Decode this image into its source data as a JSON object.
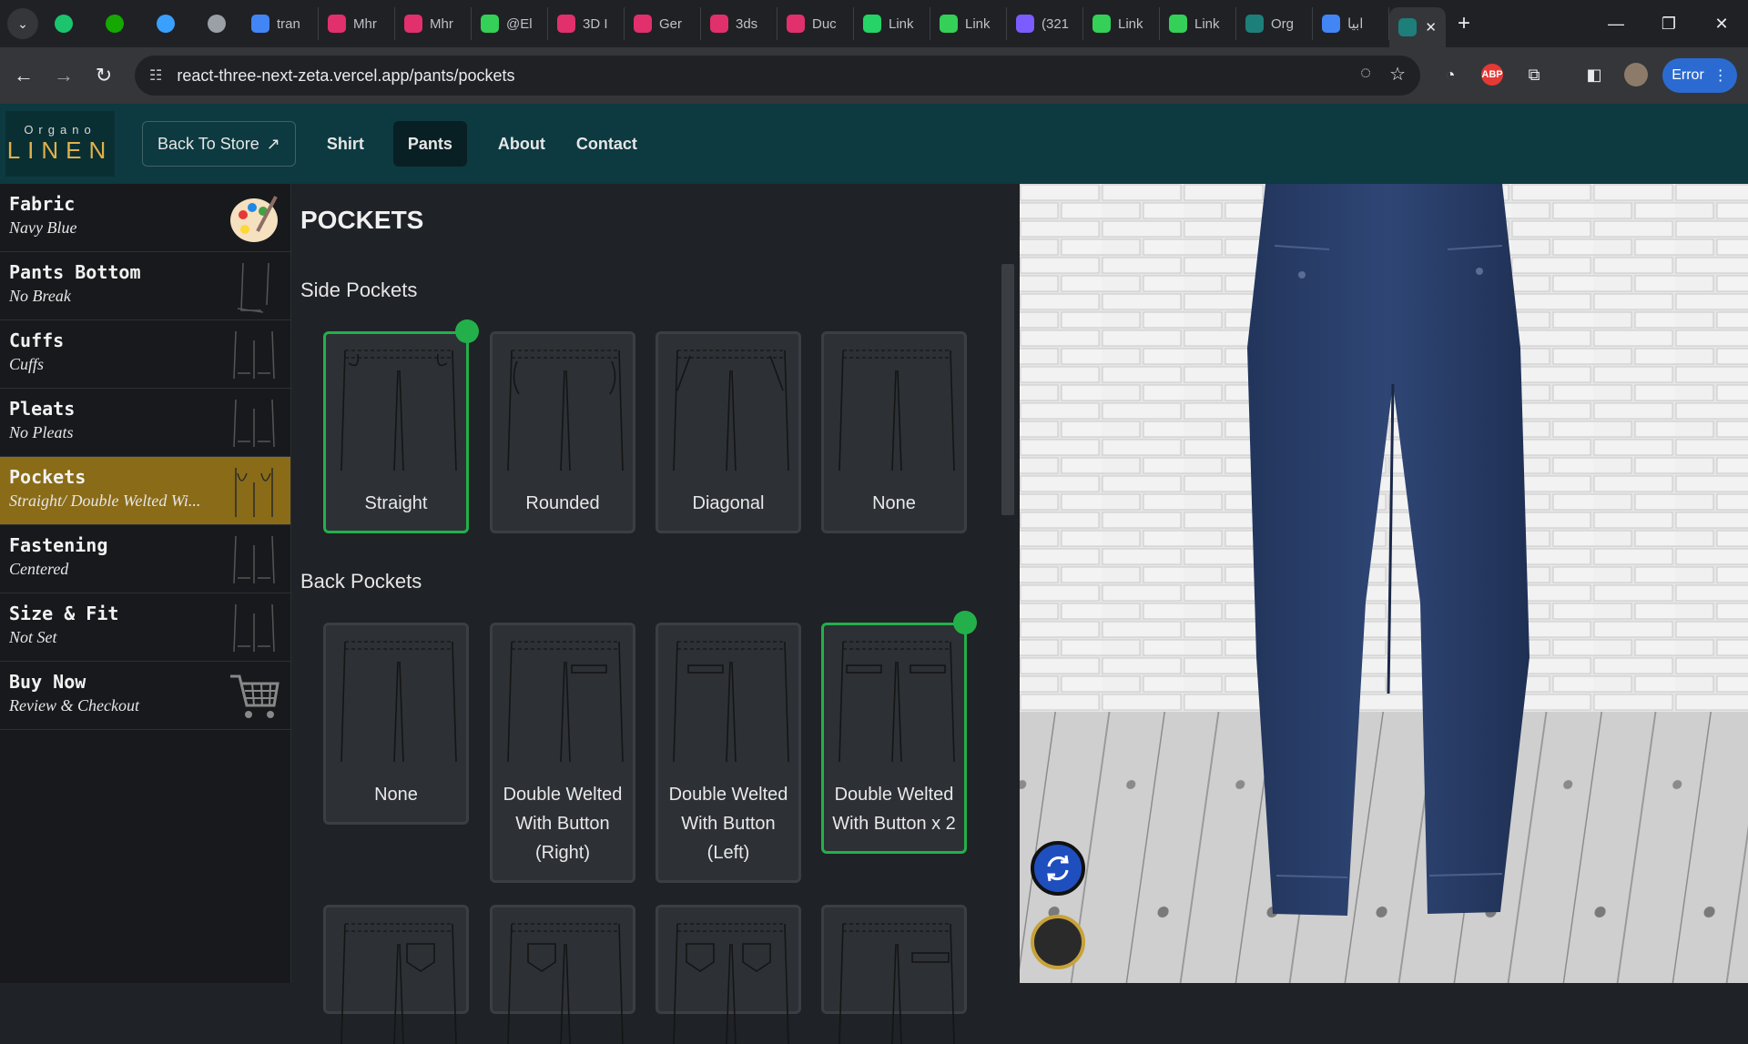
{
  "browser": {
    "tabs": [
      {
        "label": "tran",
        "color": "#4285f4"
      },
      {
        "label": "Mhr",
        "color": "#e1306c"
      },
      {
        "label": "Mhr",
        "color": "#e1306c"
      },
      {
        "label": "@El",
        "color": "#34d058"
      },
      {
        "label": "3D I",
        "color": "#e1306c"
      },
      {
        "label": "Ger",
        "color": "#e1306c"
      },
      {
        "label": "3ds",
        "color": "#e1306c"
      },
      {
        "label": "Duc",
        "color": "#e1306c"
      },
      {
        "label": "Link",
        "color": "#25d366"
      },
      {
        "label": "Link",
        "color": "#34d058"
      },
      {
        "label": "(321",
        "color": "#7b5cff"
      },
      {
        "label": "Link",
        "color": "#34d058"
      },
      {
        "label": "Link",
        "color": "#34d058"
      },
      {
        "label": "Org",
        "color": "#1d7f7a"
      },
      {
        "label": "ابيا",
        "color": "#4285f4"
      }
    ],
    "new_tab": "+",
    "url": "react-three-next-zeta.vercel.app/pants/pockets",
    "error_label": "Error"
  },
  "app": {
    "logo_top": "Organo",
    "logo_bottom": "LINEN",
    "back_to_store": "Back To Store",
    "nav": [
      "Shirt",
      "Pants",
      "About",
      "Contact"
    ],
    "active_nav": "Pants"
  },
  "sidebar": {
    "items": [
      {
        "title": "Fabric",
        "subtitle": "Navy Blue",
        "icon": "palette-icon"
      },
      {
        "title": "Pants Bottom",
        "subtitle": "No Break",
        "icon": "pants-bottom-icon"
      },
      {
        "title": "Cuffs",
        "subtitle": "Cuffs",
        "icon": "cuffs-icon"
      },
      {
        "title": "Pleats",
        "subtitle": "No Pleats",
        "icon": "pleats-icon"
      },
      {
        "title": "Pockets",
        "subtitle": "Straight/ Double Welted Wi...",
        "icon": "pockets-icon",
        "active": true
      },
      {
        "title": "Fastening",
        "subtitle": "Centered",
        "icon": "fastening-icon"
      },
      {
        "title": "Size & Fit",
        "subtitle": "Not Set",
        "icon": "size-fit-icon"
      },
      {
        "title": "Buy Now",
        "subtitle": "Review & Checkout",
        "icon": "cart-icon"
      }
    ]
  },
  "panel": {
    "title": "POCKETS",
    "side_title": "Side Pockets",
    "side_options": [
      "Straight",
      "Rounded",
      "Diagonal",
      "None"
    ],
    "side_selected": "Straight",
    "back_title": "Back Pockets",
    "back_options": [
      {
        "line1": "None",
        "line2": "",
        "line3": ""
      },
      {
        "line1": "Double Welted",
        "line2": "With Button",
        "line3": "(Right)"
      },
      {
        "line1": "Double Welted",
        "line2": "With Button",
        "line3": "(Left)"
      },
      {
        "line1": "Double Welted",
        "line2": "With Button x 2",
        "line3": ""
      }
    ],
    "back_selected": "Double Welted With Button x 2"
  },
  "colors": {
    "accent_green": "#23b04a",
    "sidebar_active": "#8a6b17",
    "header_teal": "#0c3a40",
    "pants_navy": "#2b3e66"
  }
}
